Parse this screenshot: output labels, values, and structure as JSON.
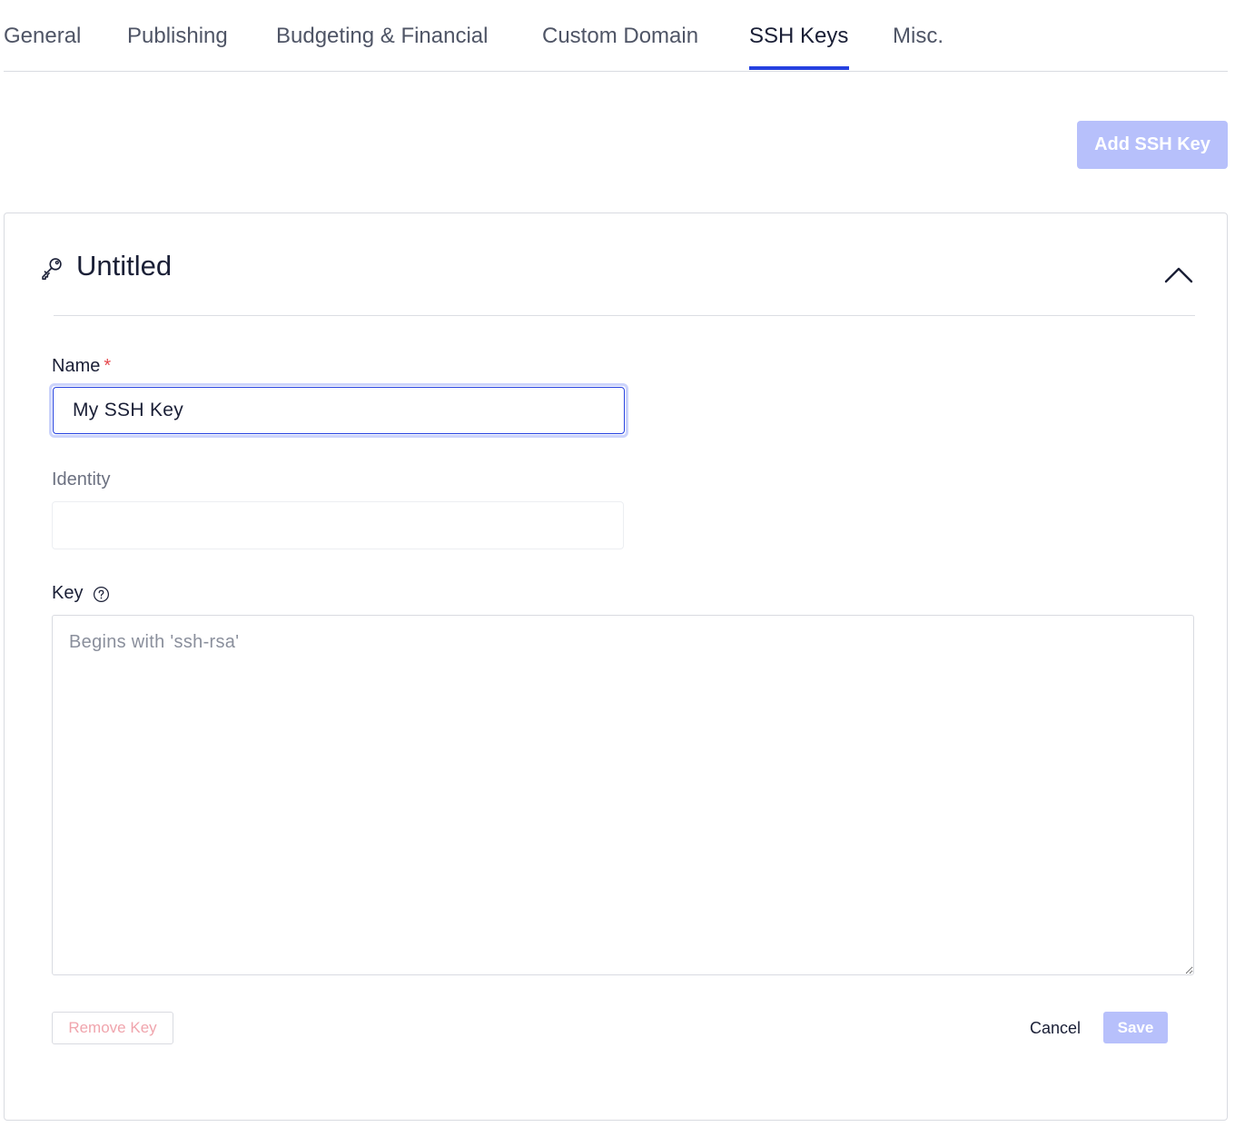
{
  "tabs": [
    {
      "label": "General",
      "active": false
    },
    {
      "label": "Publishing",
      "active": false
    },
    {
      "label": "Budgeting & Financial",
      "active": false
    },
    {
      "label": "Custom Domain",
      "active": false
    },
    {
      "label": "SSH Keys",
      "active": true
    },
    {
      "label": "Misc.",
      "active": false
    }
  ],
  "toolbar": {
    "add_label": "Add SSH Key"
  },
  "card": {
    "title": "Untitled",
    "name_label": "Name",
    "required_mark": "*",
    "name_value": "My SSH Key",
    "identity_label": "Identity",
    "identity_value": "",
    "key_label": "Key",
    "key_placeholder": "Begins with 'ssh-rsa'",
    "key_value": "",
    "remove_label": "Remove Key",
    "cancel_label": "Cancel",
    "save_label": "Save"
  },
  "icons": {
    "card": "key-icon",
    "collapse": "chevron-up-icon",
    "help": "help-circle-icon"
  },
  "colors": {
    "accent": "#2541e0",
    "button_disabled": "#b7c0fb",
    "danger_text": "#f0a5ad",
    "required": "#e5484d",
    "text": "#1a1f36"
  }
}
